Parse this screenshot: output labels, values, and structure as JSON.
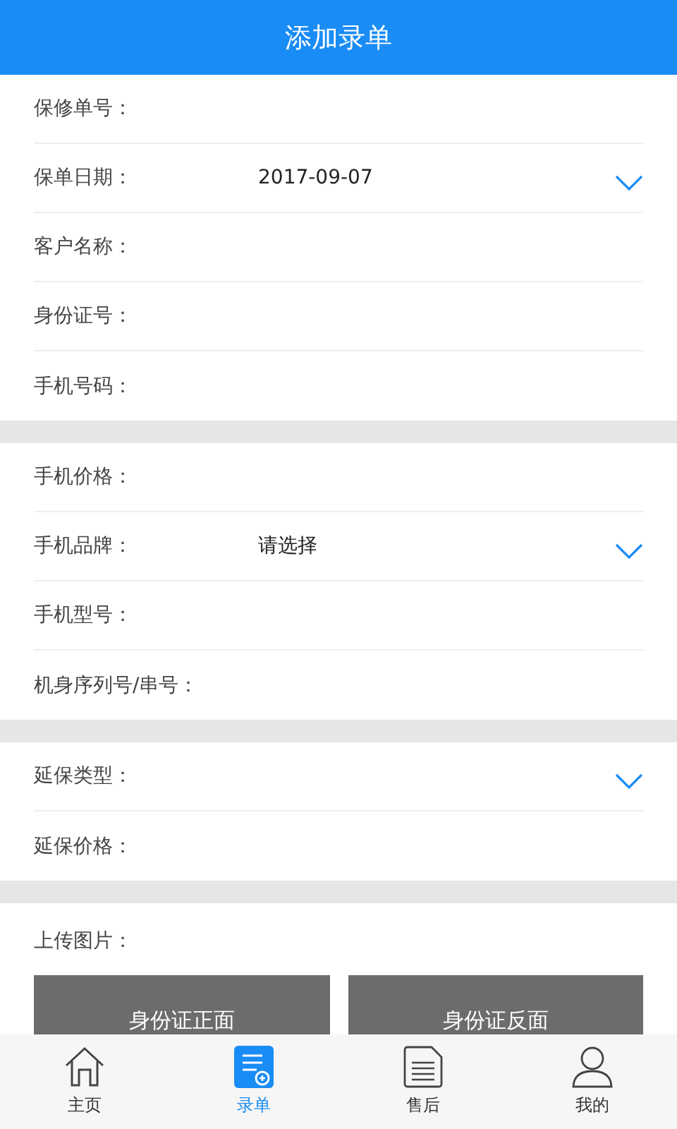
{
  "header": {
    "title": "添加录单"
  },
  "sections": [
    {
      "rows": [
        {
          "kind": "text",
          "label": "保修单号："
        },
        {
          "kind": "select",
          "label": "保单日期：",
          "value": "2017-09-07"
        },
        {
          "kind": "text",
          "label": "客户名称："
        },
        {
          "kind": "text",
          "label": "身份证号："
        },
        {
          "kind": "text",
          "label": "手机号码："
        }
      ]
    },
    {
      "rows": [
        {
          "kind": "text",
          "label": "手机价格："
        },
        {
          "kind": "select",
          "label": "手机品牌：",
          "value": "请选择"
        },
        {
          "kind": "text",
          "label": "手机型号："
        },
        {
          "kind": "text",
          "label": "机身序列号/串号："
        }
      ]
    },
    {
      "rows": [
        {
          "kind": "select",
          "label": "延保类型："
        },
        {
          "kind": "text",
          "label": "延保价格："
        }
      ]
    }
  ],
  "upload": {
    "label": "上传图片：",
    "slots": [
      "身份证正面",
      "身份证反面"
    ]
  },
  "tabs": [
    {
      "kind": "home",
      "label": "主页",
      "selected": false
    },
    {
      "kind": "add",
      "label": "录单",
      "selected": true
    },
    {
      "kind": "doc",
      "label": "售后",
      "selected": false
    },
    {
      "kind": "user",
      "label": "我的",
      "selected": false
    }
  ]
}
